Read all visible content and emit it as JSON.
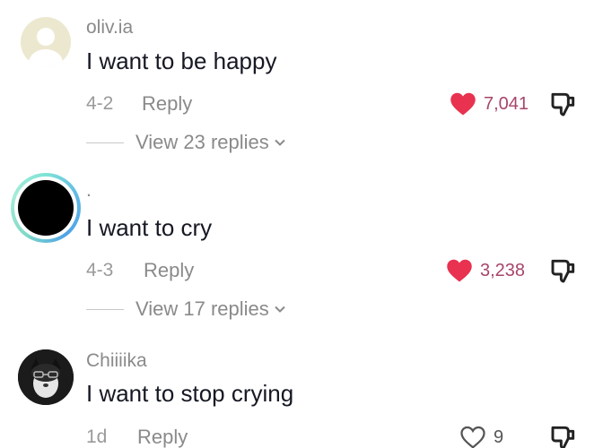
{
  "comments": [
    {
      "username": "oliv.ia",
      "text": "I want to be happy",
      "date": "4-2",
      "reply_label": "Reply",
      "likes": "7,041",
      "liked": true,
      "view_replies": "View 23 replies"
    },
    {
      "username": ".",
      "text": "I want to cry",
      "date": "4-3",
      "reply_label": "Reply",
      "likes": "3,238",
      "liked": true,
      "view_replies": "View 17 replies"
    },
    {
      "username": "Chiiiika",
      "text": "I want to stop crying",
      "date": "1d",
      "reply_label": "Reply",
      "likes": "9",
      "liked": false
    }
  ],
  "icons": {
    "like_filled": "heart-filled-icon",
    "like_outline": "heart-outline-icon",
    "dislike": "thumbs-down-icon",
    "expand": "chevron-down-icon"
  },
  "colors": {
    "liked_heart": "#e8324f",
    "liked_count": "#a8456a",
    "muted_text": "#8a8a8a",
    "primary_text": "#161823"
  }
}
